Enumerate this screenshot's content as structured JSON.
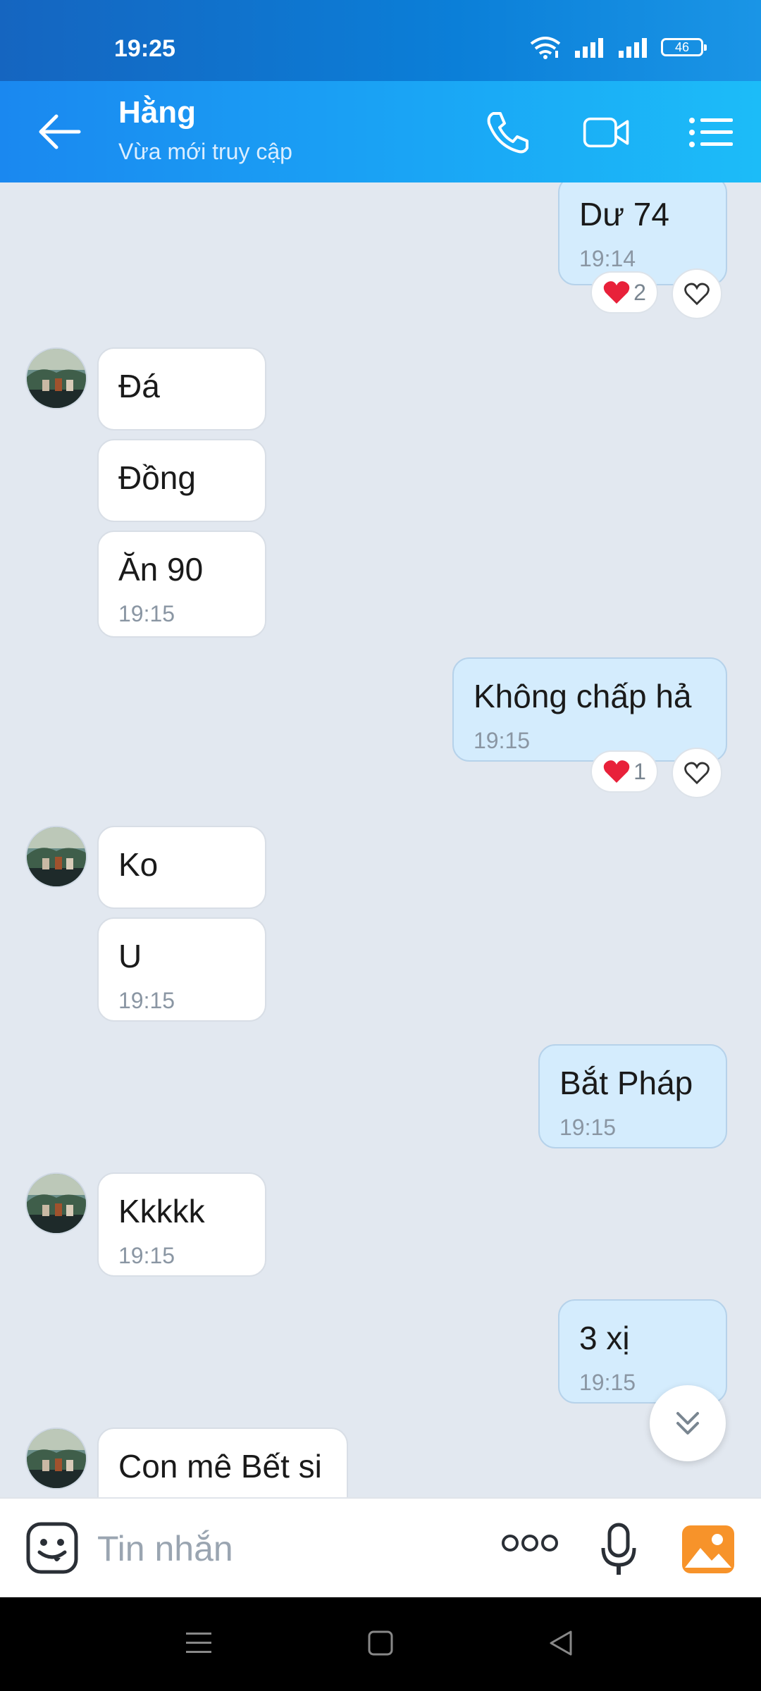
{
  "status": {
    "time": "19:25",
    "battery": "46"
  },
  "header": {
    "name": "Hằng",
    "subtitle": "Vừa mới truy cập"
  },
  "messages": [
    {
      "dir": "out",
      "text": "Dư 74",
      "time": "19:14",
      "reaction_count": "2"
    },
    {
      "dir": "in",
      "text": "Đá"
    },
    {
      "dir": "in",
      "text": "Đồng"
    },
    {
      "dir": "in",
      "text": "Ăn 90",
      "time": "19:15"
    },
    {
      "dir": "out",
      "text": "Không chấp hả",
      "time": "19:15",
      "reaction_count": "1"
    },
    {
      "dir": "in",
      "text": "Ko"
    },
    {
      "dir": "in",
      "text": "U",
      "time": "19:15"
    },
    {
      "dir": "out",
      "text": "Bắt Pháp",
      "time": "19:15"
    },
    {
      "dir": "in",
      "text": "Kkkkk",
      "time": "19:15"
    },
    {
      "dir": "out",
      "text": "3 xị",
      "time": "19:15"
    },
    {
      "dir": "in",
      "text": "Con mê Bết si"
    }
  ],
  "input": {
    "placeholder": "Tin nhắn"
  },
  "colors": {
    "header": "#1aa5f5",
    "outgoing_bubble": "#d4ecfd",
    "heart": "#e8213a"
  }
}
